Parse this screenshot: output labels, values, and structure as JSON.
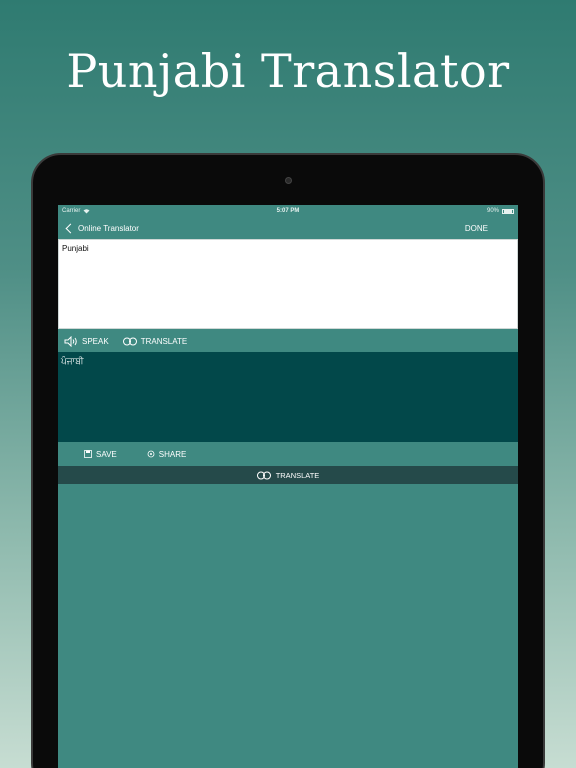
{
  "promo": {
    "title": "Punjabi Translator"
  },
  "status_bar": {
    "carrier": "Carrier",
    "time": "5:07 PM",
    "battery": "90%"
  },
  "nav": {
    "back_label": "Online Translator",
    "done_label": "DONE"
  },
  "input": {
    "text": "Punjabi"
  },
  "actions_top": {
    "speak_label": "SPEAK",
    "translate_label": "TRANSLATE"
  },
  "output": {
    "text": "ਪੰਜਾਬੀ"
  },
  "actions_bottom": {
    "save_label": "SAVE",
    "share_label": "SHARE"
  },
  "translate_strip": {
    "label": "TRANSLATE"
  },
  "icons": [
    "wifi-icon",
    "battery-icon",
    "chevron-left-icon",
    "speaker-icon",
    "translate-icon",
    "save-icon",
    "share-icon"
  ],
  "colors": {
    "screen_bg": "#3f8981",
    "output_bg": "#02484a",
    "strip_bg": "#254a4a",
    "input_bg": "#ffffff"
  }
}
